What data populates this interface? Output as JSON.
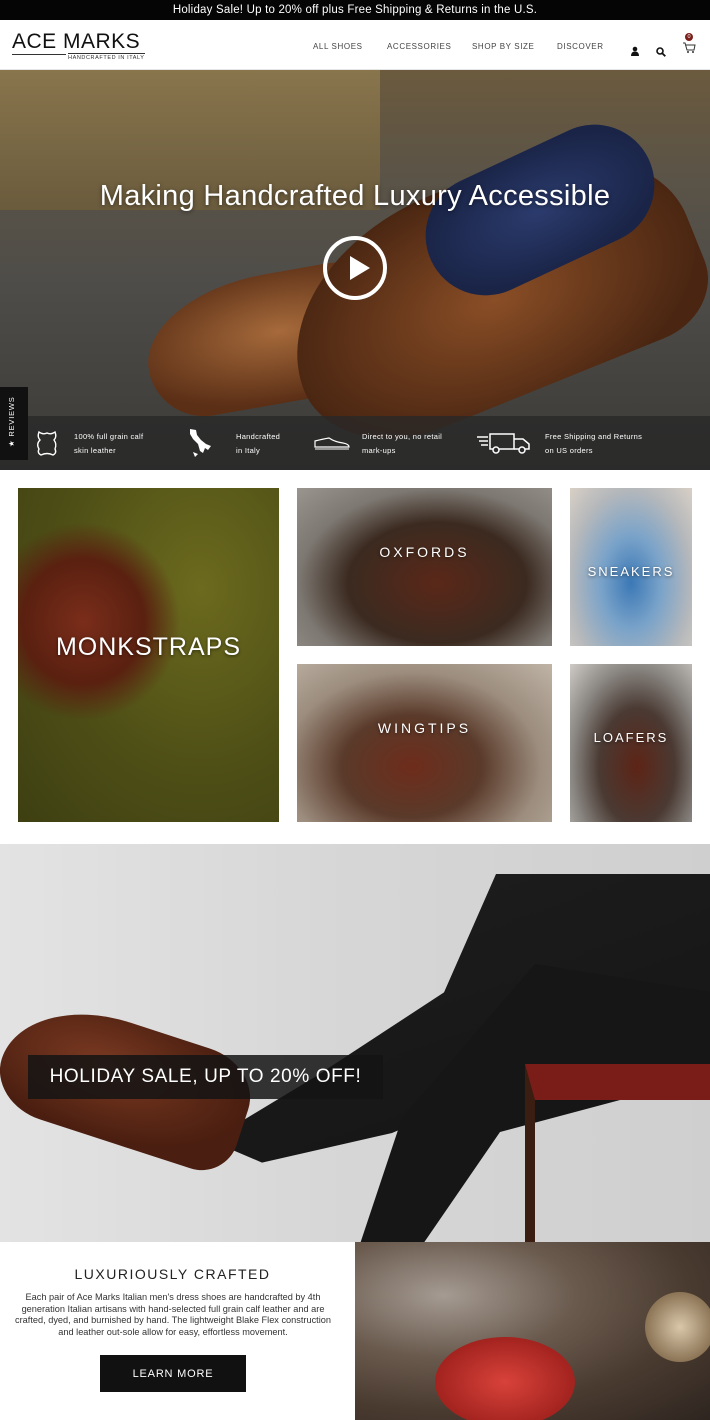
{
  "promo_bar": {
    "text": "Holiday Sale! Up to 20% off plus Free Shipping & Returns in the U.S."
  },
  "header": {
    "logo": {
      "main": "ACE MARKS",
      "sub": "HANDCRAFTED IN ITALY"
    },
    "nav": [
      {
        "label": "ALL SHOES"
      },
      {
        "label": "ACCESSORIES"
      },
      {
        "label": "SHOP BY SIZE"
      },
      {
        "label": "DISCOVER"
      }
    ],
    "icons": [
      "user-icon",
      "search-icon",
      "cart-icon"
    ],
    "cart_count": "0"
  },
  "hero": {
    "title": "Making Handcrafted Luxury Accessible",
    "play_icon": "play-icon"
  },
  "features": [
    {
      "icon": "leather-hide-icon",
      "line1": "100% full grain calf",
      "line2": "skin leather"
    },
    {
      "icon": "italy-map-icon",
      "line1": "Handcrafted",
      "line2": "in Italy"
    },
    {
      "icon": "shoe-icon",
      "line1": "Direct to you, no retail",
      "line2": "mark-ups"
    },
    {
      "icon": "truck-icon",
      "line1": "Free Shipping and Returns",
      "line2": "on US orders"
    }
  ],
  "reviews_tab": {
    "label": "★ REVIEWS"
  },
  "categories": {
    "monkstraps": "MONKSTRAPS",
    "oxfords": "OXFORDS",
    "sneakers": "SNEAKERS",
    "wingtips": "WINGTIPS",
    "loafers": "LOAFERS"
  },
  "banner": {
    "text": "HOLIDAY SALE, UP TO 20% OFF!"
  },
  "crafted": {
    "title": "LUXURIOUSLY CRAFTED",
    "body": "Each pair of Ace Marks Italian men's dress shoes are handcrafted by 4th generation Italian artisans with hand-selected full grain calf leather and are crafted, dyed, and burnished by hand. The lightweight Blake Flex construction and leather out-sole allow for easy, effortless movement.",
    "button": "LEARN MORE"
  }
}
